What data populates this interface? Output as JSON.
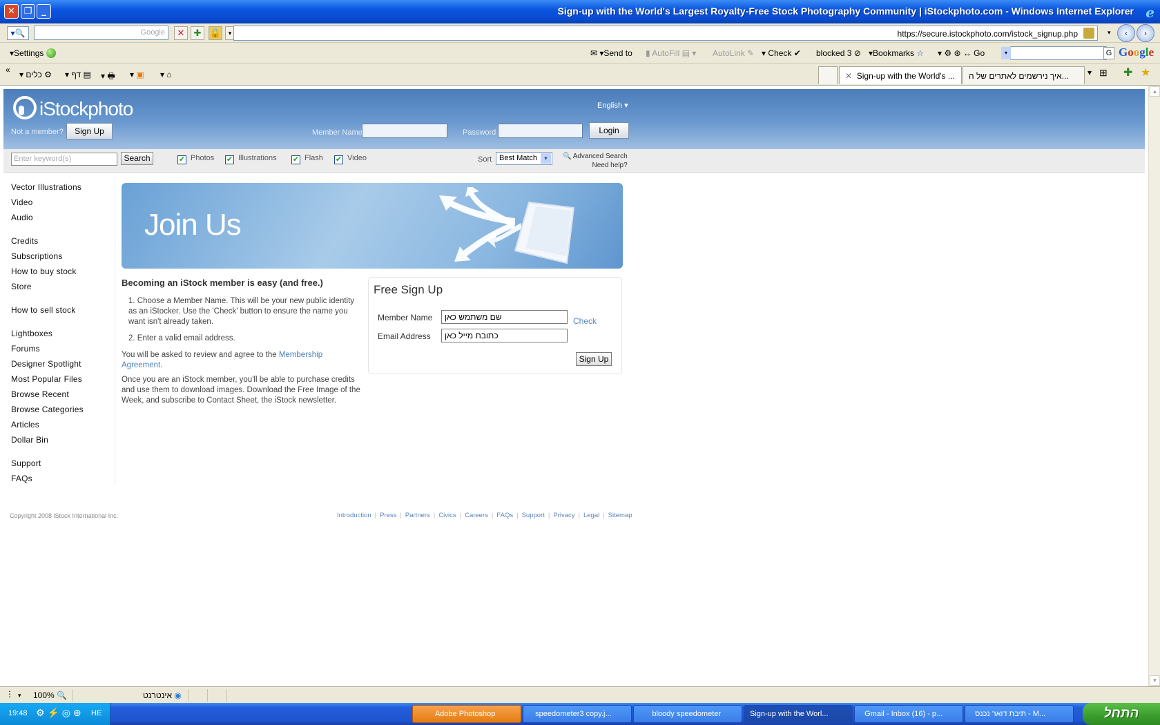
{
  "window": {
    "title": "Sign-up with the World's Largest Royalty-Free Stock Photography Community | iStockphoto.com - Windows Internet Explorer",
    "ie_logo": "e"
  },
  "addressbar": {
    "google_search_placeholder": "Google",
    "url": "https://secure.istockphoto.com/istock_signup.php"
  },
  "google_toolbar": {
    "settings": "Settings",
    "send_to": "Send to",
    "autofill": "AutoFill",
    "autolink": "AutoLink",
    "check": "Check",
    "blocked": "blocked 3",
    "bookmarks": "Bookmarks",
    "go": "Go",
    "google_logo": [
      "G",
      "o",
      "o",
      "g",
      "l",
      "e"
    ]
  },
  "tabs_toolbar": {
    "tools": "כלים",
    "page": "דף",
    "tabs": [
      {
        "label": "Sign-up with the World's ..."
      },
      {
        "label": "איך נירשמים לאתרים של ה..."
      }
    ]
  },
  "site": {
    "logo": "iStockphoto",
    "language": "English",
    "not_member": "Not a member?",
    "signup_btn": "Sign Up",
    "member_name_label": "Member Name",
    "password_label": "Password",
    "login_btn": "Login",
    "search": {
      "placeholder": "Enter keyword(s)",
      "button": "Search",
      "filters": [
        "Photos",
        "Illustrations",
        "Flash",
        "Video"
      ],
      "sort_label": "Sort",
      "sort_value": "Best Match",
      "advanced": "Advanced Search",
      "help": "Need help?"
    },
    "nav_groups": [
      [
        "Vector Illustrations",
        "Video",
        "Audio"
      ],
      [
        "Credits",
        "Subscriptions",
        "How to buy stock",
        "Store"
      ],
      [
        "How to sell stock"
      ],
      [
        "Lightboxes",
        "Forums",
        "Designer Spotlight",
        "Most Popular Files",
        "Browse Recent",
        "Browse Categories",
        "Articles",
        "Dollar Bin"
      ],
      [
        "Support",
        "FAQs"
      ]
    ],
    "banner_title": "Join Us",
    "intro_heading": "Becoming an iStock member is easy (and free.)",
    "step1": "1. Choose a Member Name. This will be your new public identity as an iStocker. Use the 'Check' button to ensure the name you want isn't already taken.",
    "step2": "2. Enter a valid email address.",
    "agree_text": "You will be asked to review and agree to the",
    "agree_link": "Membership Agreement",
    "agree_end": ".",
    "once_text": "Once you are an iStock member, you'll be able to purchase credits and use them to download images. Download the Free Image of the Week, and subscribe to Contact Sheet, the iStock newsletter.",
    "signup_box": {
      "heading": "Free Sign Up",
      "member_name_label": "Member Name",
      "member_name_value": "שם משתמש כאן",
      "check": "Check",
      "email_label": "Email Address",
      "email_value": "כתובת מייל כאן",
      "submit": "Sign Up"
    },
    "copyright": "Copyright 2008 iStock International Inc.",
    "footer_links": [
      "Introduction",
      "Press",
      "Partners",
      "Civics",
      "Careers",
      "FAQs",
      "Support",
      "Privacy",
      "Legal",
      "Sitemap"
    ]
  },
  "statusbar": {
    "zoom": "100%",
    "zone": "אינטרנט"
  },
  "taskbar": {
    "clock": "19:48",
    "lang": "HE",
    "start": "התחל",
    "buttons": [
      "Adobe Photoshop",
      "speedometer3 copy.j...",
      "bloody speedometer",
      "Sign-up with the Worl...",
      "Gmail - Inbox (16) - p...",
      "תיבת דואר נכנס - M..."
    ]
  }
}
